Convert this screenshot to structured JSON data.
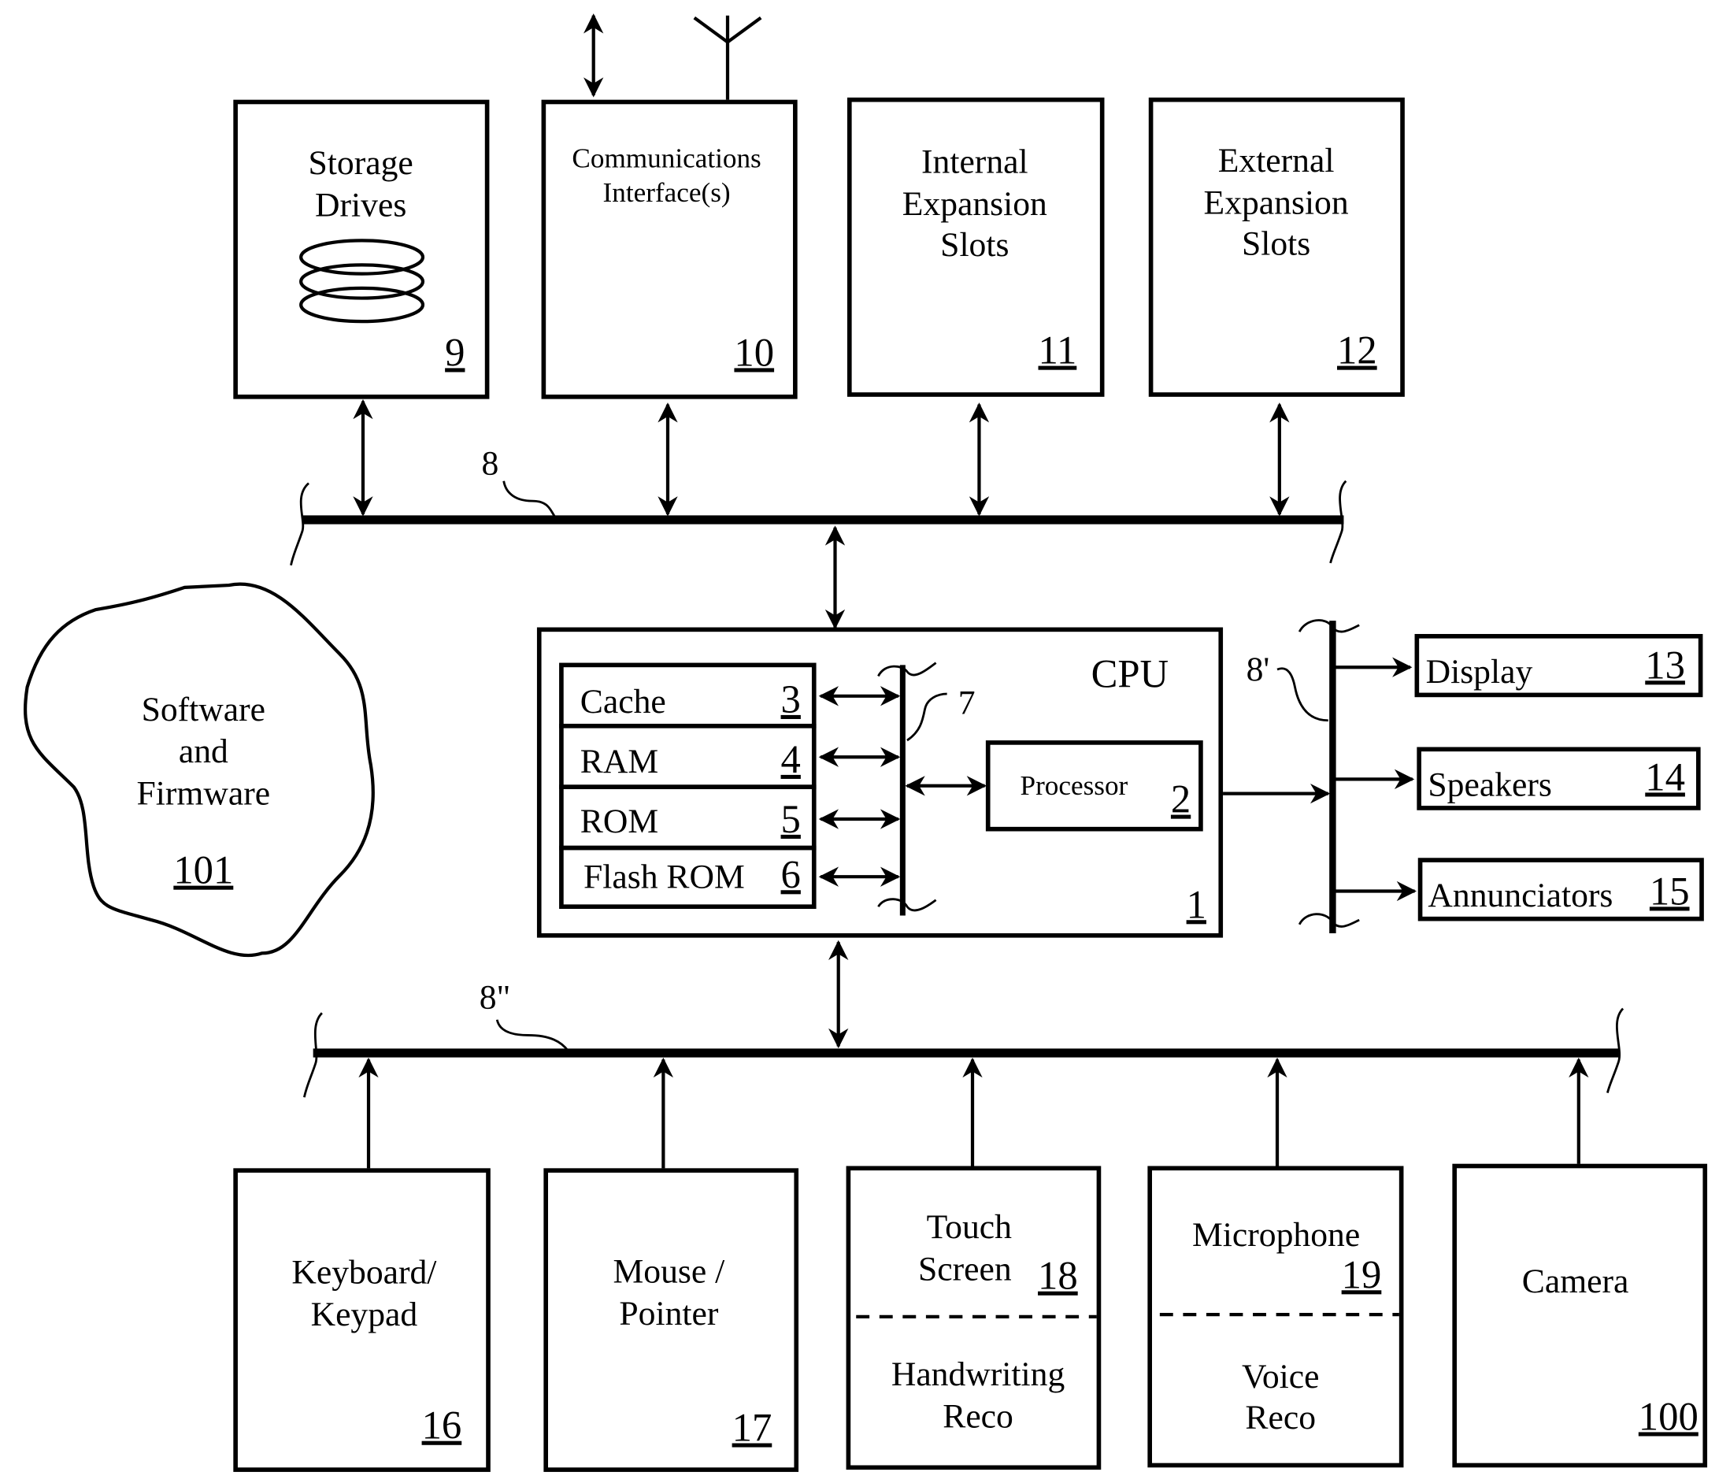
{
  "top_boxes": [
    {
      "lines": [
        "Storage",
        "Drives"
      ],
      "ref": "9"
    },
    {
      "lines": [
        "Communications",
        "Interface(s)"
      ],
      "ref": "10"
    },
    {
      "lines": [
        "Internal",
        "Expansion",
        "Slots"
      ],
      "ref": "11"
    },
    {
      "lines": [
        "External",
        "Expansion",
        "Slots"
      ],
      "ref": "12"
    }
  ],
  "buses": {
    "top": "8",
    "right": "8'",
    "bottom": "8\"",
    "internal": "7"
  },
  "cloud": {
    "lines": [
      "Software",
      "and",
      "Firmware"
    ],
    "ref": "101"
  },
  "cpu": {
    "title": "CPU",
    "ref": "1",
    "memory": [
      {
        "label": "Cache",
        "ref": "3"
      },
      {
        "label": "RAM",
        "ref": "4"
      },
      {
        "label": "ROM",
        "ref": "5"
      },
      {
        "label": "Flash ROM",
        "ref": "6"
      }
    ],
    "processor": {
      "label": "Processor",
      "ref": "2"
    }
  },
  "outputs": [
    {
      "label": "Display",
      "ref": "13"
    },
    {
      "label": "Speakers",
      "ref": "14"
    },
    {
      "label": "Annunciators",
      "ref": "15"
    }
  ],
  "bottom_boxes": [
    {
      "top_lines": [
        "Keyboard/",
        "Keypad"
      ],
      "ref": "16"
    },
    {
      "top_lines": [
        "Mouse /",
        "Pointer"
      ],
      "ref": "17"
    },
    {
      "top_lines": [
        "Touch",
        "Screen"
      ],
      "ref": "18",
      "bottom_lines": [
        "Handwriting",
        "Reco"
      ]
    },
    {
      "top_lines": [
        "Microphone"
      ],
      "ref": "19",
      "bottom_lines": [
        "Voice",
        "Reco"
      ]
    },
    {
      "top_lines": [
        "Camera"
      ],
      "ref": "100"
    }
  ]
}
